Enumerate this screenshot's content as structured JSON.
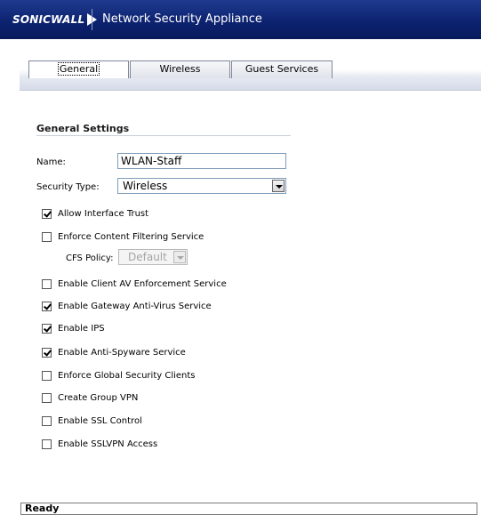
{
  "header": {
    "logo_text": "SONICWALL",
    "app_title": "Network Security Appliance"
  },
  "tabs": [
    {
      "label": "General",
      "active": true
    },
    {
      "label": "Wireless",
      "active": false
    },
    {
      "label": "Guest Services",
      "active": false
    }
  ],
  "general": {
    "section_title": "General Settings",
    "name_label": "Name:",
    "name_value": "WLAN-Staff",
    "security_type_label": "Security Type:",
    "security_type_value": "Wireless",
    "cfs_policy_label": "CFS Policy:",
    "cfs_policy_value": "Default"
  },
  "options": [
    {
      "label": "Allow Interface Trust",
      "checked": true
    },
    {
      "label": "Enforce Content Filtering Service",
      "checked": false
    },
    {
      "label": "Enable Client AV Enforcement Service",
      "checked": false
    },
    {
      "label": "Enable Gateway Anti-Virus Service",
      "checked": true
    },
    {
      "label": "Enable IPS",
      "checked": true
    },
    {
      "label": "Enable Anti-Spyware Service",
      "checked": true
    },
    {
      "label": "Enforce Global Security Clients",
      "checked": false
    },
    {
      "label": "Create Group VPN",
      "checked": false
    },
    {
      "label": "Enable SSL Control",
      "checked": false
    },
    {
      "label": "Enable SSLVPN Access",
      "checked": false
    }
  ],
  "status": {
    "text": "Ready"
  }
}
